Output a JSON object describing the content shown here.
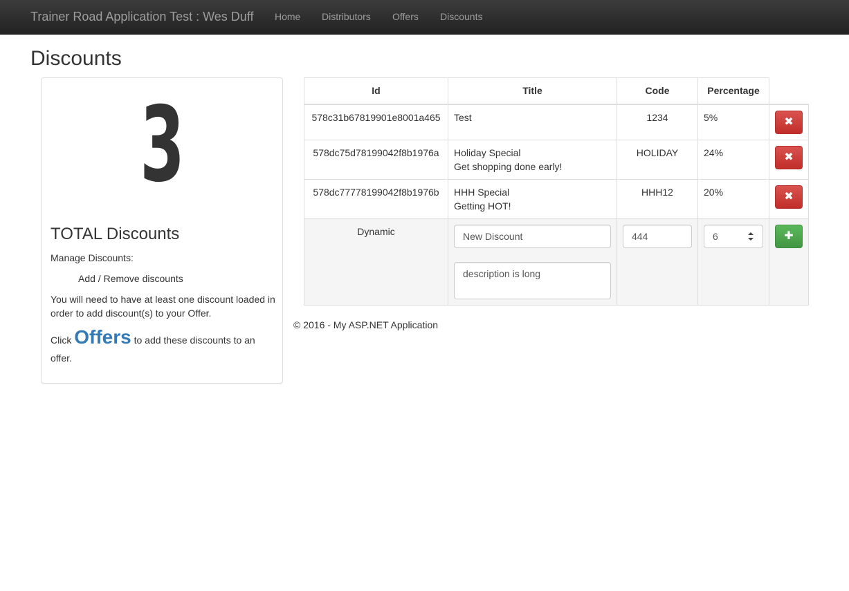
{
  "navbar": {
    "brand": "Trainer Road Application Test : Wes Duff",
    "links": [
      "Home",
      "Distributors",
      "Offers",
      "Discounts"
    ]
  },
  "page_title": "Discounts",
  "summary": {
    "count": "3",
    "title": "TOTAL Discounts",
    "manage_label": "Manage Discounts:",
    "add_remove": "Add / Remove discounts",
    "note": "You will need to have at least one discount loaded in order to add discount(s) to your Offer.",
    "click_prefix": "Click",
    "offers_link": "Offers",
    "click_suffix": "to add these discounts to an offer."
  },
  "table": {
    "headers": [
      "Id",
      "Title",
      "Code",
      "Percentage"
    ],
    "rows": [
      {
        "id": "578c31b67819901e8001a465",
        "title": "Test",
        "subtitle": "",
        "code": "1234",
        "percentage": "5%"
      },
      {
        "id": "578dc75d78199042f8b1976a",
        "title": "Holiday Special",
        "subtitle": "Get shopping done early!",
        "code": "HOLIDAY",
        "percentage": "24%"
      },
      {
        "id": "578dc77778199042f8b1976b",
        "title": "HHH Special",
        "subtitle": "Getting HOT!",
        "code": "HHH12",
        "percentage": "20%"
      }
    ],
    "new_row": {
      "id_placeholder": "Dynamic",
      "title_value": "New Discount",
      "description_value": "description is long",
      "code_value": "444",
      "percentage_value": "6"
    }
  },
  "footer": "© 2016 - My ASP.NET Application",
  "icons": {
    "delete": "remove-icon",
    "add": "plus-icon"
  },
  "colors": {
    "danger": "#d9534f",
    "success": "#5cb85c",
    "link": "#337ab7",
    "navbar": "#222222"
  }
}
